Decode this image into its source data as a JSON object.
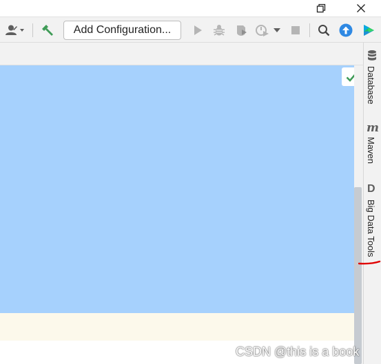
{
  "window_controls": {
    "restore_icon": "restore-icon",
    "close_icon": "close-icon"
  },
  "toolbar": {
    "add_configuration_label": "Add Configuration...",
    "icons": [
      "user-icon",
      "build-hammer-icon",
      "run-icon",
      "debug-icon",
      "coverage-icon",
      "profiler-icon",
      "stop-icon",
      "search-icon",
      "update-icon",
      "jetbrains-logo-icon"
    ],
    "colors": {
      "hammer": "#3f9b57",
      "update": "#2f89e3",
      "disabled": "#b5b5b5"
    }
  },
  "editor": {
    "selection_color": "#a6d1fd",
    "bottom_panel_color": "#fcf9eb",
    "status_check_color": "#3f9b57"
  },
  "right_sidebar": {
    "tabs": [
      {
        "label": "Database",
        "icon": "database-icon"
      },
      {
        "label": "Maven",
        "icon": "maven-m-icon",
        "glyph": "m"
      },
      {
        "label": "Big Data Tools",
        "icon": "big-data-tools-icon",
        "glyph": "D"
      }
    ]
  },
  "annotation": {
    "red_underline_color": "#e00000"
  },
  "watermark": "CSDN @this is  a book"
}
